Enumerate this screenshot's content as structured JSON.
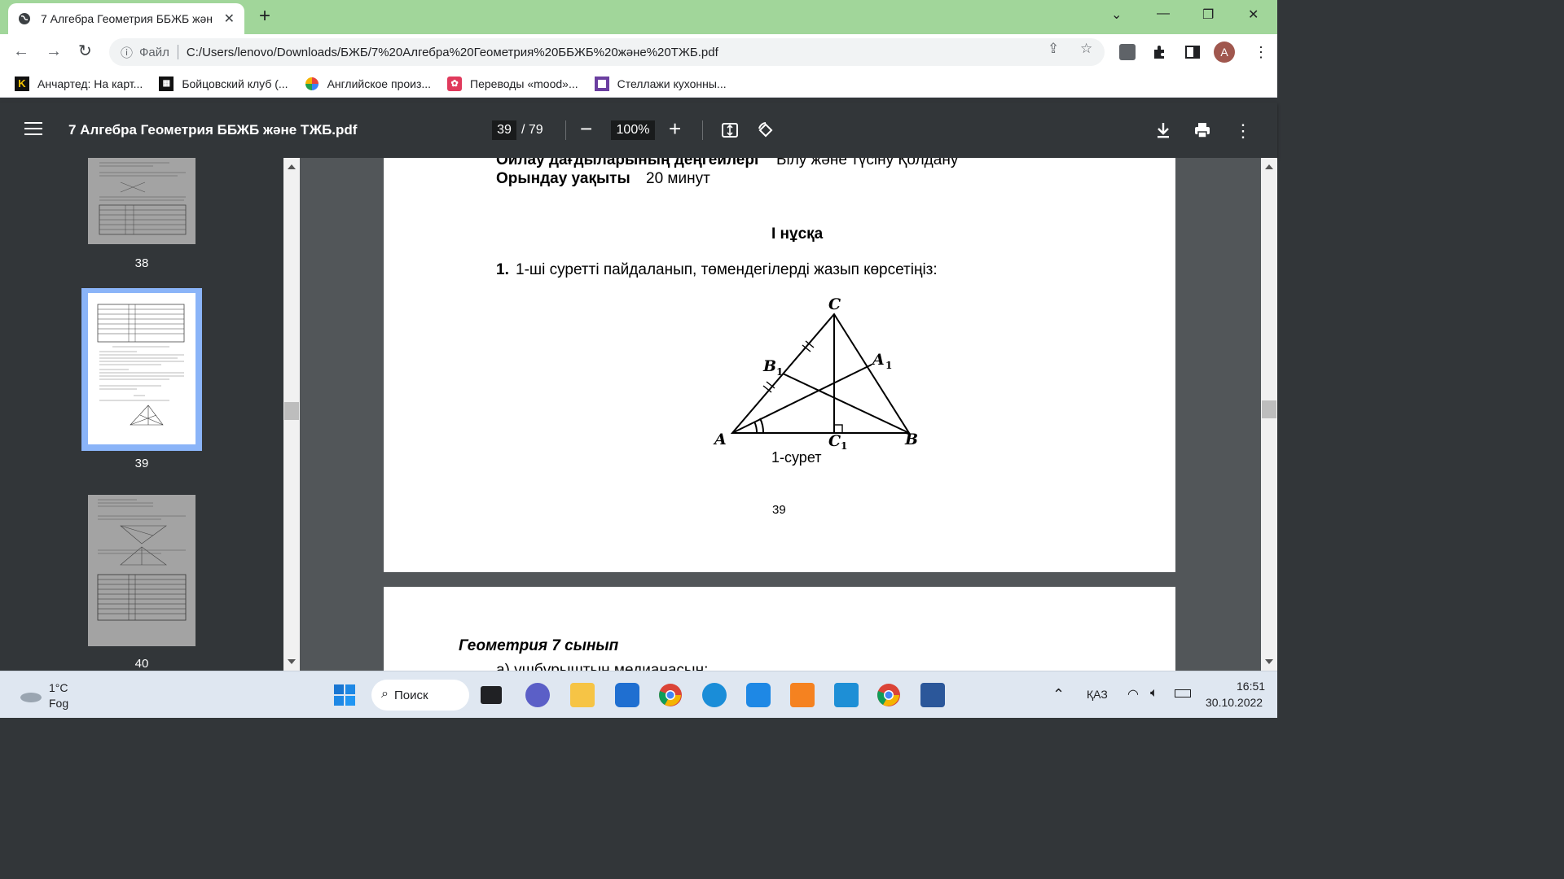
{
  "browser": {
    "tab_title": "7 Алгебра Геометрия ББЖБ жән",
    "url_scheme": "Файл",
    "url": "C:/Users/lenovo/Downloads/БЖБ/7%20Алгебра%20Геометрия%20ББЖБ%20және%20ТЖБ.pdf",
    "profile_initial": "A",
    "bookmarks": [
      {
        "label": "Анчартед: На карт...",
        "icon": "kinopoisk-icon",
        "color": "#111111"
      },
      {
        "label": "Бойцовский клуб (...",
        "icon": "film-icon",
        "color": "#111111"
      },
      {
        "label": "Английское произ...",
        "icon": "pinwheel-icon",
        "color": "#e8453c"
      },
      {
        "label": "Переводы «mood»...",
        "icon": "dictionary-icon",
        "color": "#e03a5c"
      },
      {
        "label": "Стеллажи кухонны...",
        "icon": "square-icon",
        "color": "#6b3fa0"
      }
    ]
  },
  "pdf": {
    "title": "7 Алгебра Геометрия ББЖБ және ТЖБ.pdf",
    "current_page": "39",
    "total_pages": "/ 79",
    "zoom": "100%",
    "thumbnails": [
      {
        "number": "38"
      },
      {
        "number": "39"
      },
      {
        "number": "40"
      }
    ]
  },
  "document": {
    "skills_label": "Ойлау дағдыларының деңгейлері",
    "skills_value": "Білу және түсіну Қолдану",
    "time_label": "Орындау уақыты",
    "time_value": "20 минут",
    "variant": "І нұсқа",
    "task_number": "1.",
    "task_text": "1-ші суретті пайдаланып, төмендегілерді жазып көрсетіңіз:",
    "figure": {
      "label_C": "C",
      "label_A": "A",
      "label_B": "B",
      "label_A1": "A",
      "label_B1": "B",
      "label_C1": "C",
      "subscript": "1",
      "caption": "1-сурет"
    },
    "page_number": "39",
    "next_heading": "Геометрия 7 сынып",
    "next_line": "а) үшбұрыштың медианасын;"
  },
  "taskbar": {
    "weather_temp": "1°C",
    "weather_desc": "Fog",
    "search_label": "Поиск",
    "language": "ҚАЗ",
    "time": "16:51",
    "date": "30.10.2022"
  }
}
